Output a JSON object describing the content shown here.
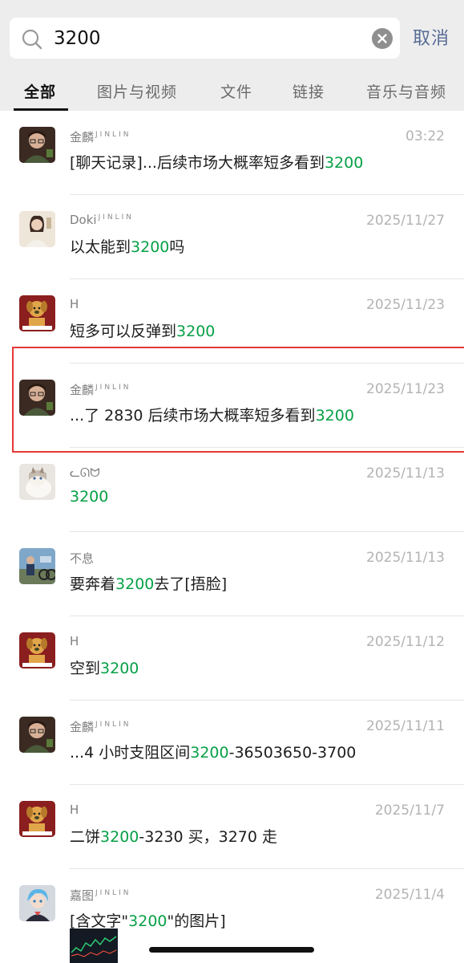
{
  "search": {
    "query": "3200",
    "cancel_label": "取消"
  },
  "tabs": [
    {
      "label": "全部",
      "active": true
    },
    {
      "label": "图片与视频",
      "active": false
    },
    {
      "label": "文件",
      "active": false
    },
    {
      "label": "链接",
      "active": false
    },
    {
      "label": "音乐与音频",
      "active": false
    }
  ],
  "results": [
    {
      "sender": "金麟",
      "sender_sub": "JINLIN",
      "date": "03:22",
      "pre": "[聊天记录]...后续市场大概率短多看到",
      "hl": "3200",
      "post": "",
      "avatar": "man-glasses"
    },
    {
      "sender": "Doki",
      "sender_sub": "JINLIN",
      "date": "2025/11/27",
      "pre": "以太能到",
      "hl": "3200",
      "post": "吗",
      "avatar": "woman"
    },
    {
      "sender": "H",
      "sender_sub": "",
      "date": "2025/11/23",
      "pre": "短多可以反弹到",
      "hl": "3200",
      "post": "",
      "avatar": "dog"
    },
    {
      "sender": "金麟",
      "sender_sub": "JINLIN",
      "date": "2025/11/23",
      "pre": "...了 2830 后续市场大概率短多看到",
      "hl": "3200",
      "post": "",
      "avatar": "man-glasses"
    },
    {
      "sender": "ᓚᘏᗢ",
      "sender_sub": "",
      "date": "2025/11/13",
      "pre": "",
      "hl": "3200",
      "post": "",
      "avatar": "cat"
    },
    {
      "sender": "不息",
      "sender_sub": "",
      "date": "2025/11/13",
      "pre": "要奔着",
      "hl": "3200",
      "post": "去了[捂脸]",
      "avatar": "person-outdoor"
    },
    {
      "sender": "H",
      "sender_sub": "",
      "date": "2025/11/12",
      "pre": "空到",
      "hl": "3200",
      "post": "",
      "avatar": "dog"
    },
    {
      "sender": "金麟",
      "sender_sub": "JINLIN",
      "date": "2025/11/11",
      "pre": "...4 小时支阻区间",
      "hl": "3200",
      "post": "-36503650-3700",
      "avatar": "man-glasses"
    },
    {
      "sender": "H",
      "sender_sub": "",
      "date": "2025/11/7",
      "pre": "二饼",
      "hl": "3200",
      "post": "-3230 买，3270 走",
      "avatar": "dog"
    },
    {
      "sender": "嘉图",
      "sender_sub": "JINLIN",
      "date": "2025/11/4",
      "pre": "[含文字\"",
      "hl": "3200",
      "post": "\"的图片]",
      "avatar": "anime-blue"
    }
  ]
}
